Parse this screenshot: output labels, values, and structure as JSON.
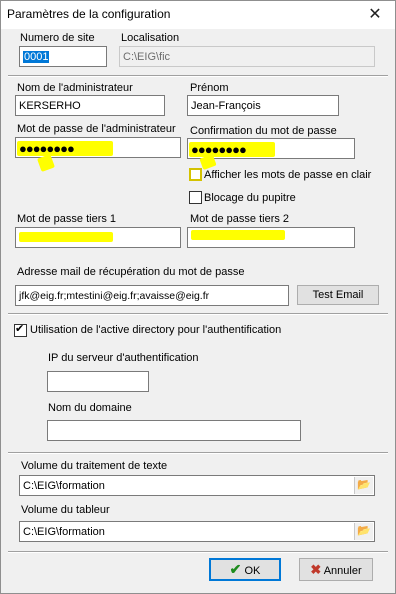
{
  "window": {
    "title": "Paramètres de la configuration",
    "close_glyph": "✕"
  },
  "site": {
    "number_label": "Numero de site",
    "number_value": "0001",
    "location_label": "Localisation",
    "location_value": "C:\\EIG\\fic"
  },
  "admin": {
    "name_label": "Nom  de l'administrateur",
    "name_value": "KERSERHO",
    "firstname_label": "Prénom",
    "firstname_value": "Jean-François",
    "password_label": "Mot de passe de l'administrateur",
    "password_value": "●●●●●●●●",
    "confirm_label": "Confirmation du mot de passe",
    "confirm_value": "●●●●●●●●",
    "show_passwords_label": "Afficher les mots de passe en clair",
    "show_passwords_checked": false,
    "lock_desk_label": "Blocage du pupitre",
    "lock_desk_checked": false,
    "third_password1_label": "Mot de passe tiers 1",
    "third_password1_value": "",
    "third_password2_label": "Mot de passe tiers 2",
    "third_password2_value": ""
  },
  "recovery": {
    "email_label": "Adresse mail de récupération du mot de passe",
    "email_value": "jfk@eig.fr;mtestini@eig.fr;avaisse@eig.fr",
    "test_button": "Test Email"
  },
  "ad": {
    "use_ad_label": "Utilisation de l'active directory pour l'authentification",
    "use_ad_checked": true,
    "check_glyph": "✔",
    "server_ip_label": "IP du serveur d'authentification",
    "server_ip_value": "",
    "domain_label": "Nom du domaine",
    "domain_value": ""
  },
  "volumes": {
    "word_label": "Volume du traitement de texte",
    "word_value": "C:\\EIG\\formation",
    "sheet_label": "Volume du tableur",
    "sheet_value": "C:\\EIG\\formation",
    "folder_glyph": "📂"
  },
  "buttons": {
    "ok_label": "OK",
    "ok_glyph": "✔",
    "ok_color": "#1e8c1e",
    "cancel_label": "Annuler",
    "cancel_glyph": "✖",
    "cancel_color": "#c0392b"
  },
  "colors": {
    "highlight": "#ffff00",
    "selection": "#0078d7"
  }
}
